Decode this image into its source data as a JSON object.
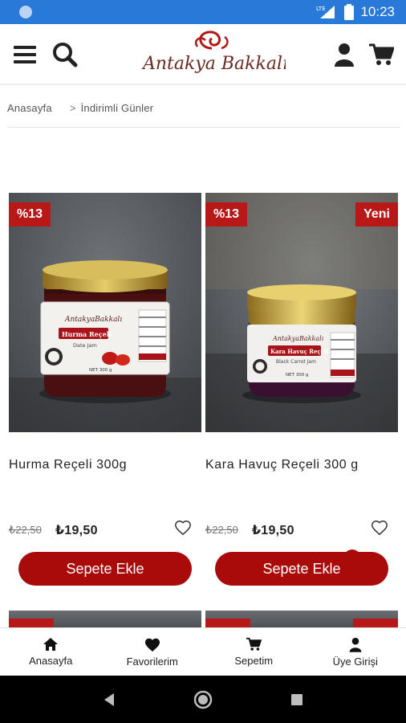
{
  "status_bar": {
    "time": "10:23",
    "network": "LTE"
  },
  "header": {
    "brand_name": "Antakya Bakkalı",
    "brand_color": "#a90a0a"
  },
  "breadcrumb": {
    "home": "Anasayfa",
    "separator": ">",
    "current": "İndirimli Günler"
  },
  "products": [
    {
      "name": "Hurma Reçeli 300g",
      "old_price": "₺22,50",
      "new_price": "₺19,50",
      "discount_badge": "%13",
      "new_badge": "",
      "add_to_cart": "Sepete Ekle",
      "jar_label": "Hurma Reçeli",
      "jar_sublabel": "Date Jam",
      "jar_brand": "AntakyaBakkalı",
      "jar_weight": "NET 300 g"
    },
    {
      "name": "Kara Havuç Reçeli 300 g",
      "old_price": "₺22,50",
      "new_price": "₺19,50",
      "discount_badge": "%13",
      "new_badge": "Yeni",
      "add_to_cart": "Sepete Ekle",
      "jar_label": "Kara Havuç Reçeli",
      "jar_sublabel": "Black Carrot Jam",
      "jar_brand": "AntakyaBakkalı",
      "jar_weight": "NET 300 g"
    }
  ],
  "bottom_nav": [
    {
      "label": "Anasayfa",
      "icon": "home-icon"
    },
    {
      "label": "Favorilerim",
      "icon": "heart-icon"
    },
    {
      "label": "Sepetim",
      "icon": "cart-icon"
    },
    {
      "label": "Üye Girişi",
      "icon": "user-icon"
    }
  ],
  "colors": {
    "status_bar": "#2979d9",
    "accent": "#a90a0a",
    "badge": "#b81818"
  }
}
